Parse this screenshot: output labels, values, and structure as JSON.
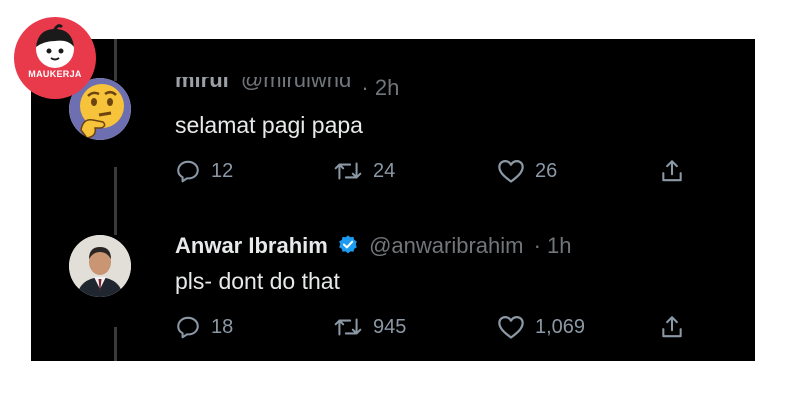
{
  "brand": {
    "logo_text": "MAUKERJA"
  },
  "colors": {
    "background": "#000000",
    "text": "#e7e9ea",
    "muted": "#8b98a5",
    "verified": "#1d9bf0",
    "logo": "#e93a4b"
  },
  "tweets": [
    {
      "display_name": "mirul",
      "handle": "@mirulwnd",
      "time": "· 2h",
      "text": "selamat pagi papa",
      "avatar_icon": "thinking-face-emoji",
      "actions": {
        "replies": "12",
        "retweets": "24",
        "likes": "26"
      }
    },
    {
      "display_name": "Anwar Ibrahim",
      "verified": true,
      "handle": "@anwaribrahim",
      "time": "· 1h",
      "text": "pls- dont do that",
      "avatar_icon": "profile-photo",
      "actions": {
        "replies": "18",
        "retweets": "945",
        "likes": "1,069"
      }
    }
  ],
  "icons": [
    "reply-icon",
    "retweet-icon",
    "like-icon",
    "share-icon",
    "verified-badge-icon"
  ]
}
